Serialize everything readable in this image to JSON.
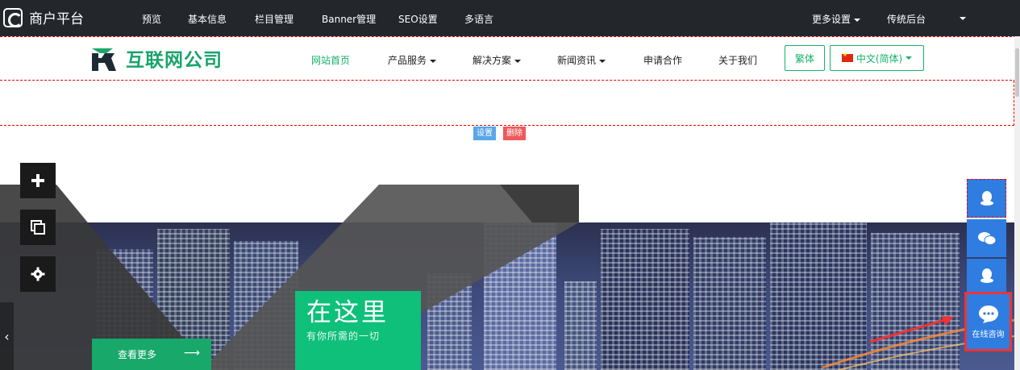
{
  "topbar": {
    "brand": "商户平台",
    "nav": [
      "预览",
      "基本信息",
      "栏目管理",
      "Banner管理",
      "SEO设置",
      "多语言"
    ],
    "more_settings": "更多设置",
    "legacy_admin": "传统后台"
  },
  "header": {
    "logo_text": "互联网公司",
    "nav": [
      "网站首页",
      "产品服务",
      "解决方案",
      "新闻资讯",
      "申请合作",
      "关于我们"
    ],
    "traditional_btn": "繁体",
    "language_btn": "中文(简体)"
  },
  "module_tags": {
    "settings": "设置",
    "delete": "删除"
  },
  "banner": {
    "title": "在这里",
    "subtitle": "有你所需的一切",
    "more_button": "查看更多",
    "more_arrow": "⟶",
    "prev_arrow": "‹"
  },
  "service": {
    "consult_label": "在线咨询"
  },
  "colors": {
    "brand_green": "#17b26a",
    "admin_bar": "#23262b",
    "service_blue": "#2f7de1"
  }
}
